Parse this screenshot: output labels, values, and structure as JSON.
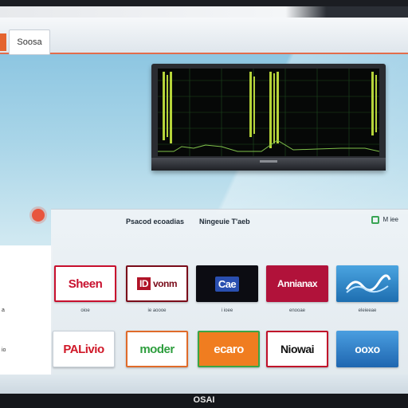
{
  "header": {
    "tab_label": "Soosa",
    "right_text_1": "",
    "right_text_2": ""
  },
  "apps_panel": {
    "header_left": "Psacod ecoadias",
    "header_center": "Ningeuie T'aeb",
    "header_right": "M iee"
  },
  "side_panel": {
    "items": [
      "a",
      "io"
    ]
  },
  "apps_row1": [
    {
      "label": "Sheen",
      "caption": "oioe",
      "bg": "#ffffff",
      "fg": "#c8102e",
      "border": "#c8102e"
    },
    {
      "label": "vonm",
      "caption": "ie aoooe",
      "bg": "#ffffff",
      "fg": "#7a0c1a",
      "border": "#7a0c1a"
    },
    {
      "label": "Cae",
      "caption": "i ioee",
      "bg": "#0c0c12",
      "fg": "#ffffff",
      "border": "#0c0c12"
    },
    {
      "label": "Annianax",
      "caption": "enooae",
      "bg": "#b1123a",
      "fg": "#ffffff",
      "border": "#b1123a"
    },
    {
      "label": "",
      "caption": "eleieeae",
      "bg": "#2f8ad0",
      "fg": "#ffffff",
      "border": "#2f8ad0"
    }
  ],
  "apps_row2": [
    {
      "label": "PALivio",
      "bg": "#ffffff",
      "fg": "#d01828",
      "border": "#c8d0d8"
    },
    {
      "label": "moder",
      "bg": "#ffffff",
      "fg": "#2e9e3e",
      "border": "#e06b2a"
    },
    {
      "label": "ecaro",
      "bg": "#f07d20",
      "fg": "#ffffff",
      "border": "#3aa545"
    },
    {
      "label": "Niowai",
      "bg": "#ffffff",
      "fg": "#111111",
      "border": "#c0102a"
    },
    {
      "label": "ooxo",
      "bg": "#2c86cc",
      "fg": "#ffffff",
      "border": "#2c86cc"
    }
  ],
  "brand": "OSAI",
  "colors": {
    "accent": "#e26d4c",
    "wall": "#7ebede",
    "bezel": "#15171b"
  },
  "icons": {
    "notification": "red-dot-icon",
    "panel_header": "green-square-icon"
  }
}
